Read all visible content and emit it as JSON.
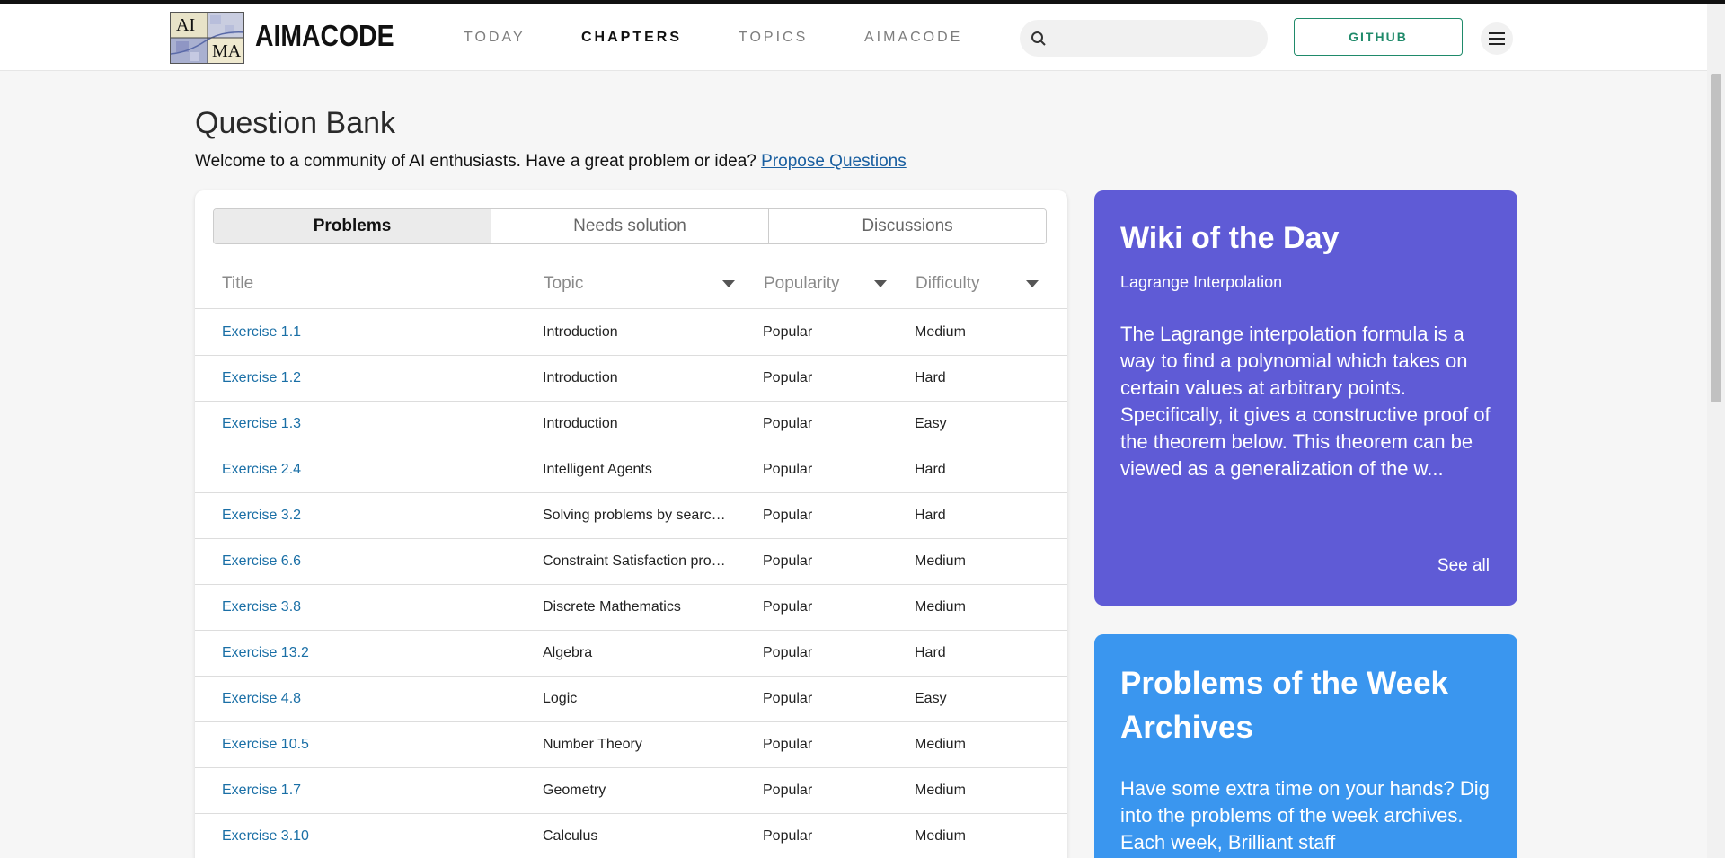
{
  "nav": {
    "logo_text": "AIMACODE",
    "logo_letters": [
      "AI",
      "MA"
    ],
    "links": [
      "TODAY",
      "CHAPTERS",
      "TOPICS",
      "AIMACODE"
    ],
    "active_link": "CHAPTERS",
    "search_placeholder": "",
    "github_label": "GITHUB",
    "colors": {
      "accent": "#1f8a6a"
    }
  },
  "page": {
    "title": "Question Bank",
    "welcome_text": "Welcome to a community of AI enthusiasts. Have a great problem or idea?",
    "propose_link": "Propose Questions"
  },
  "tabs": [
    "Problems",
    "Needs solution",
    "Discussions"
  ],
  "table": {
    "headers": [
      "Title",
      "Topic",
      "Popularity",
      "Difficulty"
    ],
    "rows": [
      [
        "Exercise 1.1",
        "Introduction",
        "Popular",
        "Medium"
      ],
      [
        "Exercise 1.2",
        "Introduction",
        "Popular",
        "Hard"
      ],
      [
        "Exercise 1.3",
        "Introduction",
        "Popular",
        "Easy"
      ],
      [
        "Exercise 2.4",
        "Intelligent Agents",
        "Popular",
        "Hard"
      ],
      [
        "Exercise 3.2",
        "Solving problems by searc…",
        "Popular",
        "Hard"
      ],
      [
        "Exercise 6.6",
        "Constraint Satisfaction pro…",
        "Popular",
        "Medium"
      ],
      [
        "Exercise 3.8",
        "Discrete Mathematics",
        "Popular",
        "Medium"
      ],
      [
        "Exercise 13.2",
        "Algebra",
        "Popular",
        "Hard"
      ],
      [
        "Exercise 4.8",
        "Logic",
        "Popular",
        "Easy"
      ],
      [
        "Exercise 10.5",
        "Number Theory",
        "Popular",
        "Medium"
      ],
      [
        "Exercise 1.7",
        "Geometry",
        "Popular",
        "Medium"
      ],
      [
        "Exercise 3.10",
        "Calculus",
        "Popular",
        "Medium"
      ]
    ]
  },
  "wiki": {
    "heading": "Wiki of the Day",
    "subtitle": "Lagrange Interpolation",
    "body": "The Lagrange interpolation formula is a way to find a polynomial which takes on certain values at arbitrary points. Specifically, it gives a constructive proof of the theorem below. This theorem can be viewed as a generalization of the w...",
    "see_all": "See all",
    "color": "#5f5bd6"
  },
  "potw": {
    "heading": "Problems of the Week Archives",
    "body": "Have some extra time on your hands? Dig into the problems of the week archives. Each week, Brilliant staff",
    "color": "#3a96ef"
  },
  "icons": [
    "search-icon",
    "hamburger-menu-icon",
    "chevron-down-icon"
  ]
}
